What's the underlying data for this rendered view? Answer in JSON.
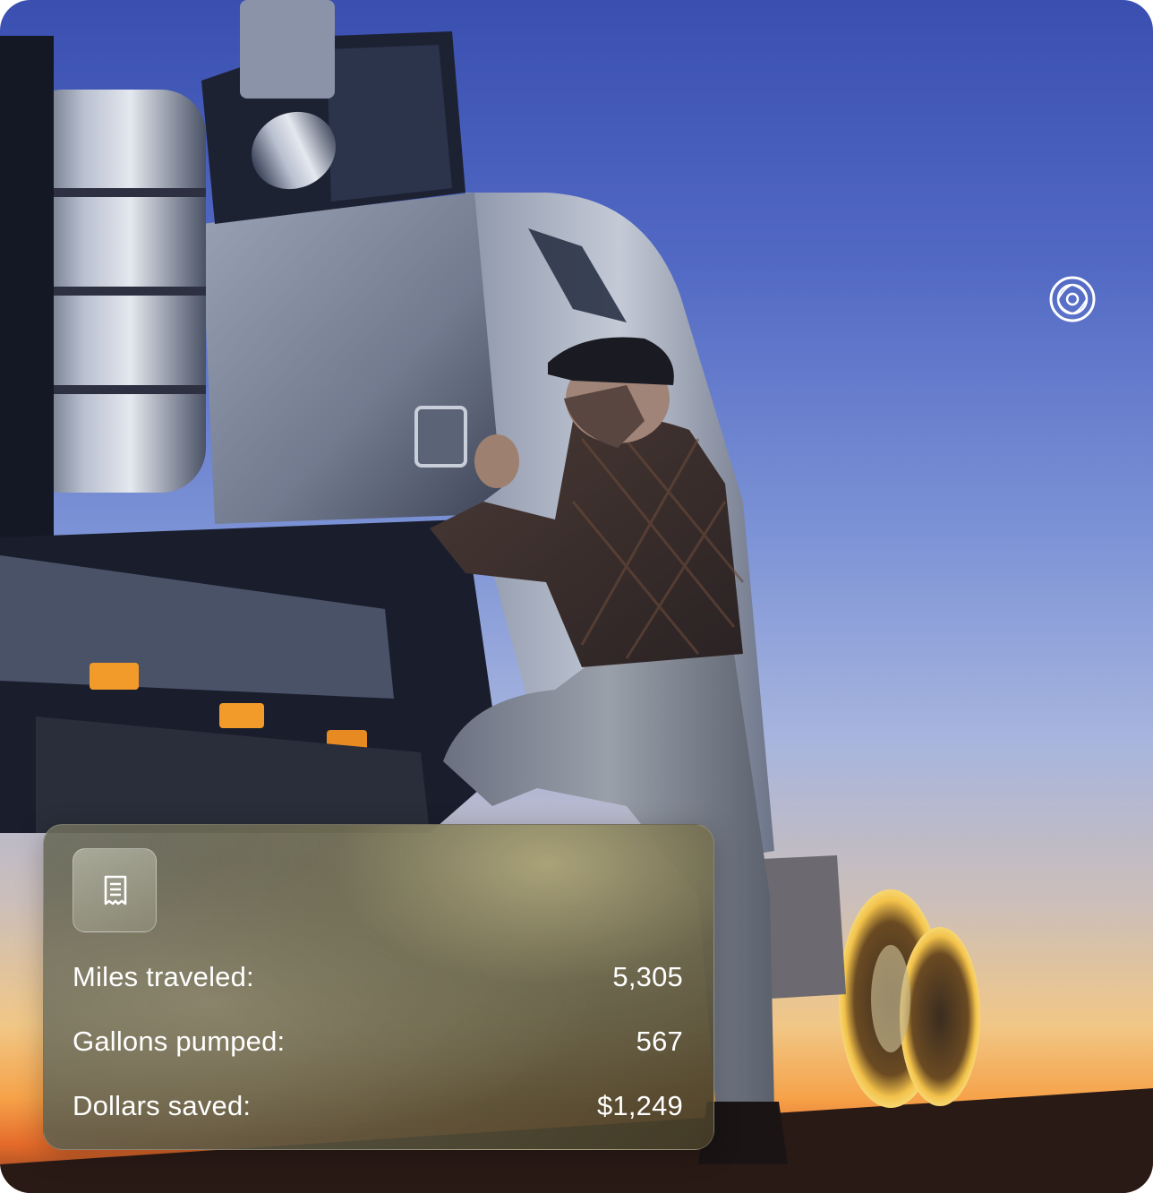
{
  "colors": {
    "sky_top": "#3a4fb0",
    "sunset": "#f6a34a",
    "card_text": "#ffffff"
  },
  "icons": {
    "brand": "orbit-logo-icon",
    "receipt": "receipt-icon"
  },
  "stats": [
    {
      "label": "Miles traveled:",
      "value": "5,305"
    },
    {
      "label": "Gallons pumped:",
      "value": "567"
    },
    {
      "label": "Dollars saved:",
      "value": "$1,249"
    }
  ]
}
